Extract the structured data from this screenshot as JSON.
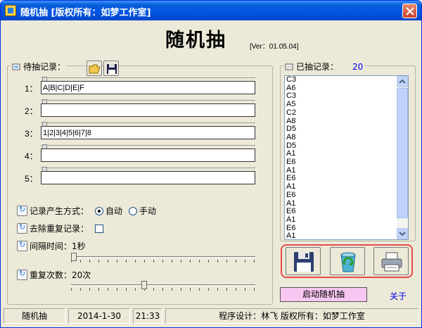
{
  "window": {
    "title": "随机抽   [版权所有：如梦工作室]",
    "heading": "随机抽",
    "version": "[Ver：01.05.04]"
  },
  "pending": {
    "label": "待抽记录：",
    "rows": [
      {
        "label": "1：",
        "value": "A|B|C|D|E|F"
      },
      {
        "label": "2：",
        "value": ""
      },
      {
        "label": "3：",
        "value": "1|2|3|4|5|6|7|8"
      },
      {
        "label": "4：",
        "value": ""
      },
      {
        "label": "5：",
        "value": ""
      }
    ]
  },
  "options": {
    "mode_label": "记录产生方式：",
    "mode_auto": "自动",
    "mode_manual": "手动",
    "mode_selected": "自动",
    "dedupe_label": "去除重复记录：",
    "dedupe_checked": false,
    "interval_label": "间隔时间：1秒",
    "interval_value": 1,
    "repeat_label": "重复次数：20次",
    "repeat_value": 20
  },
  "drawn": {
    "label": "已抽记录：",
    "count": "20",
    "items": [
      "C3",
      "A6",
      "C3",
      "A5",
      "C2",
      "A8",
      "D5",
      "A8",
      "D5",
      "A1",
      "E6",
      "A1",
      "E6",
      "A1",
      "E6",
      "A1",
      "E6",
      "A1",
      "E6",
      "A1"
    ]
  },
  "actions": {
    "save_icon": "floppy-disk-icon",
    "refresh_icon": "recycle-bin-icon",
    "print_icon": "printer-icon",
    "start_label": "启动随机抽",
    "about_label": "关于"
  },
  "status": {
    "app": "随机抽",
    "date": "2014-1-30",
    "time": "21:33",
    "credit": "程序设计：林飞  版权所有：如梦工作室"
  },
  "colors": {
    "titlebar": "#0054e3",
    "highlight": "#e34b4b",
    "start_button": "#f7c7f2",
    "link": "#0000ee"
  }
}
